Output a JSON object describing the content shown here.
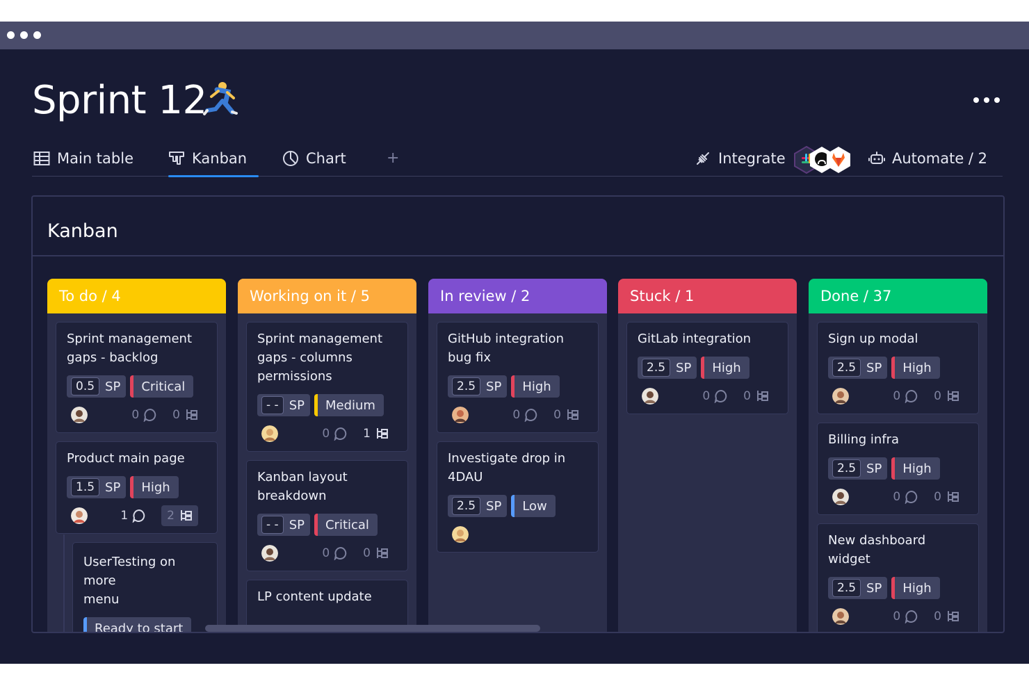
{
  "window": {
    "dots": [
      "dot",
      "dot",
      "dot"
    ]
  },
  "page": {
    "title": "Sprint 12",
    "title_emoji": "runner-icon"
  },
  "tabs": [
    {
      "label": "Main table",
      "icon": "table-icon"
    },
    {
      "label": "Kanban",
      "icon": "kanban-icon",
      "active": true
    },
    {
      "label": "Chart",
      "icon": "chart-icon"
    }
  ],
  "add_view": "+",
  "integrate": {
    "label": "Integrate",
    "apps": [
      "slack-icon",
      "github-icon",
      "gitlab-icon"
    ]
  },
  "automate": {
    "label": "Automate / 2"
  },
  "panel": {
    "title": "Kanban"
  },
  "colors": {
    "todo": "#fdca00",
    "working": "#fdab3d",
    "review": "#7e4fd0",
    "stuck": "#e2445c",
    "done": "#00c875",
    "critical": "#e2445c",
    "high": "#e2445c",
    "medium": "#fdca00",
    "low": "#579bfc",
    "ready": "#579bfc",
    "accent": "#2a8bf2"
  },
  "columns": [
    {
      "label": "To do / 4",
      "cards": [
        {
          "title": "Sprint management\ngaps - backlog",
          "sp": "0.5",
          "sp_unit": "SP",
          "priority": "Critical",
          "comments": "0",
          "subitems": "0"
        },
        {
          "title": "Product main page",
          "sp": "1.5",
          "sp_unit": "SP",
          "priority": "High",
          "comments": "1",
          "subitems": "2"
        },
        {
          "title": "UserTesting on more\nmenu",
          "status": "Ready to start"
        }
      ]
    },
    {
      "label": "Working on it / 5",
      "cards": [
        {
          "title": "Sprint management\ngaps - columns\npermissions",
          "sp": "- -",
          "sp_unit": "SP",
          "priority": "Medium",
          "comments": "0",
          "subitems": "1"
        },
        {
          "title": "Kanban layout\nbreakdown",
          "sp": "- -",
          "sp_unit": "SP",
          "priority": "Critical",
          "comments": "0",
          "subitems": "0"
        },
        {
          "title": "LP content update"
        }
      ]
    },
    {
      "label": "In review / 2",
      "cards": [
        {
          "title": "GitHub integration\nbug fix",
          "sp": "2.5",
          "sp_unit": "SP",
          "priority": "High",
          "comments": "0",
          "subitems": "0"
        },
        {
          "title": "Investigate drop in\n4DAU",
          "sp": "2.5",
          "sp_unit": "SP",
          "priority": "Low"
        }
      ]
    },
    {
      "label": "Stuck / 1",
      "cards": [
        {
          "title": "GitLab integration",
          "sp": "2.5",
          "sp_unit": "SP",
          "priority": "High",
          "comments": "0",
          "subitems": "0"
        }
      ]
    },
    {
      "label": "Done  / 37",
      "cards": [
        {
          "title": "Sign up modal",
          "sp": "2.5",
          "sp_unit": "SP",
          "priority": "High",
          "comments": "0",
          "subitems": "0"
        },
        {
          "title": "Billing infra",
          "sp": "2.5",
          "sp_unit": "SP",
          "priority": "High",
          "comments": "0",
          "subitems": "0"
        },
        {
          "title": "New dashboard\nwidget",
          "sp": "2.5",
          "sp_unit": "SP",
          "priority": "High",
          "comments": "0",
          "subitems": "0"
        }
      ]
    }
  ]
}
